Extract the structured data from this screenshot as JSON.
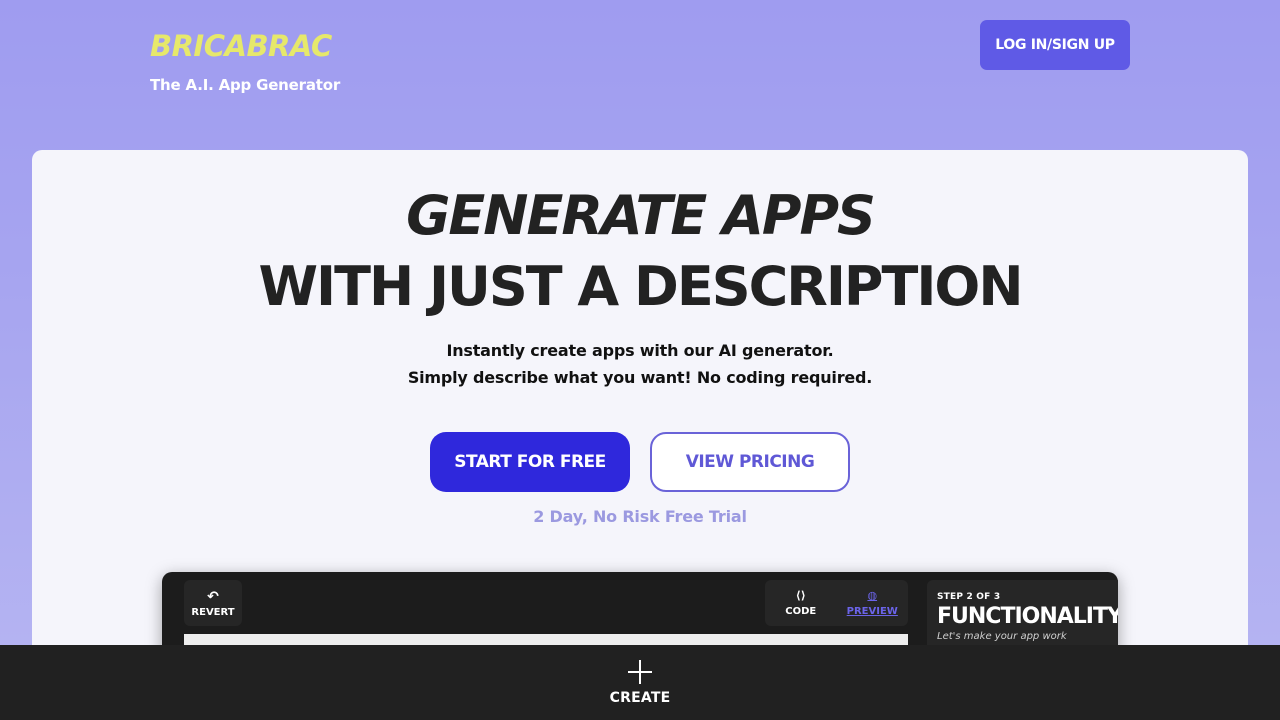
{
  "header": {
    "logo": "BRICABRAC",
    "tagline": "The A.I. App Generator",
    "login_label": "LOG IN/SIGN UP"
  },
  "hero": {
    "title_line1": "GENERATE APPS",
    "title_line2": "WITH JUST A DESCRIPTION",
    "subtitle_line1": "Instantly create apps with our AI generator.",
    "subtitle_line2": "Simply describe what you want! No coding required.",
    "start_label": "START FOR FREE",
    "pricing_label": "VIEW PRICING",
    "trial_text": "2 Day, No Risk Free Trial"
  },
  "preview": {
    "revert_label": "REVERT",
    "revert_icon": "undo-icon",
    "tabs": [
      {
        "label": "CODE",
        "icon": "code-icon",
        "active": false
      },
      {
        "label": "PREVIEW",
        "icon": "globe-icon",
        "active": true
      }
    ],
    "step_label": "STEP 2 OF 3",
    "step_title": "FUNCTIONALITY",
    "step_desc": "Let's make your app work"
  },
  "bottom_bar": {
    "create_label": "CREATE",
    "create_icon": "plus-icon"
  },
  "colors": {
    "logo": "#e6e86b",
    "primary": "#2f28dc",
    "login": "#5f5ae6",
    "accent": "#6b64e8"
  }
}
